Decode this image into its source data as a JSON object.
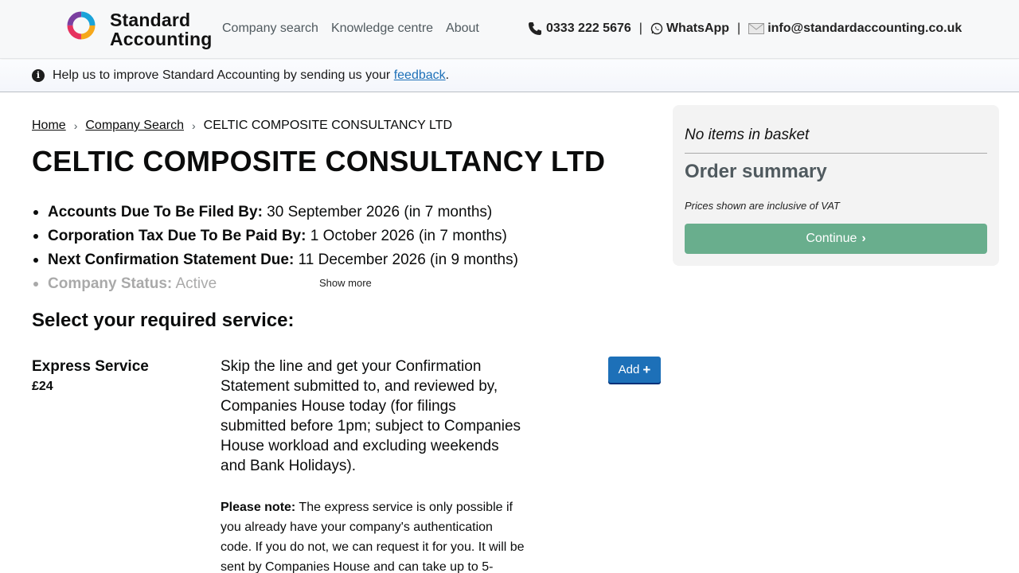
{
  "header": {
    "brand_line1": "Standard",
    "brand_line2": "Accounting",
    "nav": [
      "Company search",
      "Knowledge centre",
      "About"
    ],
    "phone": "0333 222 5676",
    "whatsapp": "WhatsApp",
    "email": "info@standardaccounting.co.uk",
    "separator": "|"
  },
  "banner": {
    "text": "Help us to improve Standard Accounting by sending us your ",
    "link": "feedback",
    "tail": "."
  },
  "breadcrumb": {
    "home": "Home",
    "company_search": "Company Search",
    "current": "CELTIC COMPOSITE CONSULTANCY LTD"
  },
  "page": {
    "title": "CELTIC COMPOSITE CONSULTANCY LTD",
    "facts": [
      {
        "label": "Accounts Due To Be Filed By:",
        "value": " 30 September 2026 (in 7 months)"
      },
      {
        "label": "Corporation Tax Due To Be Paid By:",
        "value": " 1 October 2026 (in 7 months)"
      },
      {
        "label": "Next Confirmation Statement Due:",
        "value": " 11 December 2026 (in 9 months)"
      },
      {
        "label": "Company Status:",
        "value": " Active"
      }
    ],
    "show_more": "Show more",
    "section_title": "Select your required service:"
  },
  "service": {
    "name": "Express Service",
    "price": "£24",
    "description": "Skip the line and get your Confirmation Statement submitted to, and reviewed by, Companies House today (for filings submitted before 1pm; subject to Companies House workload and excluding weekends and Bank Holidays).",
    "note_label": "Please note:",
    "note_text": " The express service is only possible if you already have your company's authentication code. If you do not, we can request it for you. It will be sent by Companies House and can take up to 5-",
    "add_label": "Add",
    "add_icon": "plus-icon"
  },
  "summary": {
    "empty": "No items in basket",
    "title": "Order summary",
    "vat": "Prices shown are inclusive of VAT",
    "continue": "Continue"
  },
  "colors": {
    "primary_blue": "#1d70b8",
    "continue_green": "#69ae8d",
    "link_blue": "#1d70b8"
  }
}
